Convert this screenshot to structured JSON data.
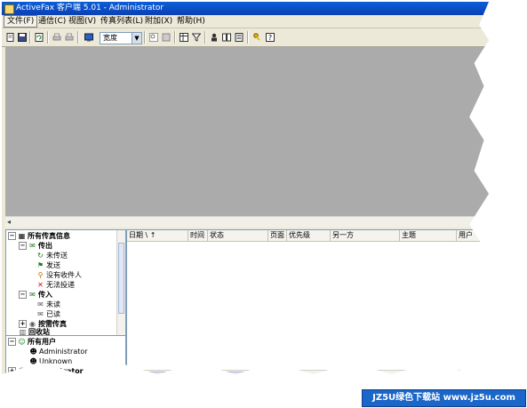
{
  "window": {
    "title": "ActiveFax 客户端 5.01 - Administrator"
  },
  "menu": [
    "文件(F)",
    "通信(C)",
    "视图(V)",
    "传真列表(L)",
    "附加(X)",
    "帮助(H)"
  ],
  "toolbar": {
    "view_combo": "宽度"
  },
  "tree": {
    "root": "所有传真信息",
    "outbox": "传出",
    "unsent": "未传送",
    "sent": "发送",
    "no_recipient": "没有收件人",
    "failed": "无法投递",
    "inbox": "传入",
    "unread": "未读",
    "read": "已读",
    "archive": "按需传真",
    "recycle": "回收站"
  },
  "users": {
    "root": "所有用户",
    "admin_user": "Administrator",
    "unknown_user": "Unknown",
    "admin_group": "Administrator"
  },
  "columns": [
    "日期 \\ ↑",
    "时间",
    "状态",
    "页面",
    "优先级",
    "另一方",
    "主题",
    "用户"
  ],
  "watermark": "JZ5U绿色下载站 www.jz5u.com",
  "colors": {
    "titlebar": "#0b4fd0",
    "preview_bg": "#ababab",
    "watermark_bg": "#1a66c9"
  }
}
